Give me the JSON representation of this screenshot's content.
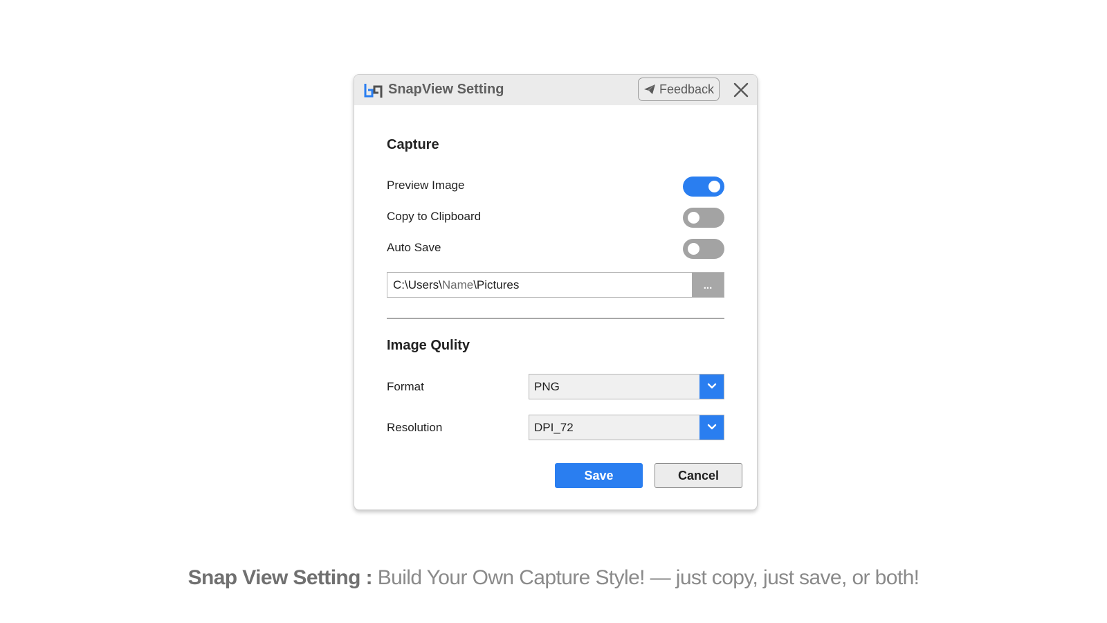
{
  "window": {
    "title": "SnapView Setting",
    "logo_icon": "bp-logo-icon",
    "feedback_label": "Feedback",
    "feedback_icon": "paper-plane-icon",
    "close_icon": "close-icon"
  },
  "capture": {
    "heading": "Capture",
    "preview_image": {
      "label": "Preview Image",
      "enabled": true
    },
    "copy_to_clipboard": {
      "label": "Copy to Clipboard",
      "enabled": false
    },
    "auto_save": {
      "label": "Auto Save",
      "enabled": false
    },
    "save_path": {
      "prefix": "C:\\Users\\",
      "user": "Name",
      "suffix": "\\Pictures",
      "browse_label": "..."
    }
  },
  "image_quality": {
    "heading": "Image Qulity",
    "format": {
      "label": "Format",
      "value": "PNG"
    },
    "resolution": {
      "label": "Resolution",
      "value": "DPI_72"
    },
    "dropdown_icon": "chevron-down-icon"
  },
  "actions": {
    "save_label": "Save",
    "cancel_label": "Cancel"
  },
  "caption": {
    "bold": "Snap View Setting :",
    "text": " Build Your Own Capture Style! — just copy, just save, or both!"
  },
  "colors": {
    "accent": "#2a7ef0",
    "toggle_off": "#a3a3a3",
    "titlebar": "#ebebeb"
  }
}
